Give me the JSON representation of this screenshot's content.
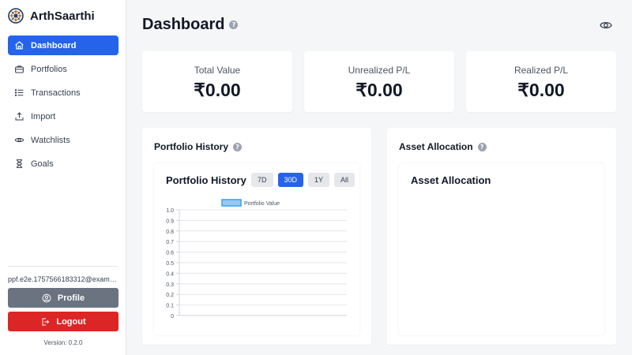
{
  "app": {
    "name": "ArthSaarthi",
    "version": "Version: 0.2.0"
  },
  "sidebar": {
    "items": [
      {
        "label": "Dashboard",
        "icon": "home-icon"
      },
      {
        "label": "Portfolios",
        "icon": "briefcase-icon"
      },
      {
        "label": "Transactions",
        "icon": "list-icon"
      },
      {
        "label": "Import",
        "icon": "upload-icon"
      },
      {
        "label": "Watchlists",
        "icon": "eye-icon"
      },
      {
        "label": "Goals",
        "icon": "hourglass-icon"
      }
    ],
    "active_index": 0,
    "user_email": "ppf.e2e.1757566183312@example.com",
    "profile_label": "Profile",
    "logout_label": "Logout"
  },
  "page": {
    "title": "Dashboard",
    "help_icon": "question-icon",
    "privacy_icon": "eye-icon"
  },
  "stats": [
    {
      "label": "Total Value",
      "value": "₹0.00"
    },
    {
      "label": "Unrealized P/L",
      "value": "₹0.00"
    },
    {
      "label": "Realized P/L",
      "value": "₹0.00"
    }
  ],
  "portfolio_history": {
    "panel_title": "Portfolio History",
    "chart_title": "Portfolio History",
    "ranges": [
      "7D",
      "30D",
      "1Y",
      "All"
    ],
    "active_range": "30D"
  },
  "asset_allocation": {
    "panel_title": "Asset Allocation",
    "chart_title": "Asset Allocation"
  },
  "colors": {
    "accent": "#2563eb",
    "danger": "#dc2626",
    "muted_button": "#6b7280",
    "series_fill": "#9ac8f2",
    "series_stroke": "#36a2eb"
  },
  "chart_data": {
    "type": "line",
    "title": "Portfolio History",
    "series": [
      {
        "name": "Portfolio Value",
        "values": []
      }
    ],
    "x": [],
    "y_ticks": [
      "1.0",
      "0.9",
      "0.8",
      "0.7",
      "0.6",
      "0.5",
      "0.4",
      "0.3",
      "0.2",
      "0.1",
      "0"
    ],
    "ylim": [
      0,
      1
    ],
    "grid": true,
    "legend": "top-center"
  }
}
